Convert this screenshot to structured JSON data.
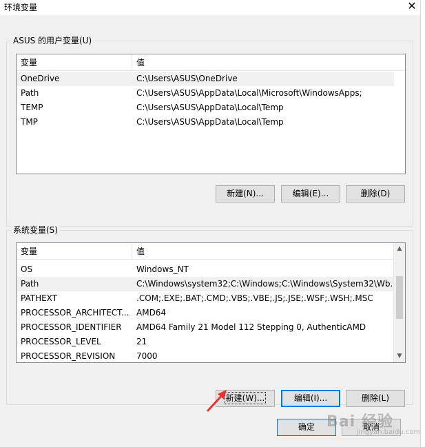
{
  "window": {
    "title": "环境变量",
    "close_glyph": "✕"
  },
  "user_vars": {
    "group_label": "ASUS 的用户变量(U)",
    "columns": [
      "变量",
      "值"
    ],
    "rows": [
      {
        "name": "OneDrive",
        "value": "C:\\Users\\ASUS\\OneDrive",
        "selected": true
      },
      {
        "name": "Path",
        "value": "C:\\Users\\ASUS\\AppData\\Local\\Microsoft\\WindowsApps;",
        "selected": false
      },
      {
        "name": "TEMP",
        "value": "C:\\Users\\ASUS\\AppData\\Local\\Temp",
        "selected": false
      },
      {
        "name": "TMP",
        "value": "C:\\Users\\ASUS\\AppData\\Local\\Temp",
        "selected": false
      }
    ],
    "buttons": {
      "new": "新建(N)...",
      "edit": "编辑(E)...",
      "delete": "删除(D)"
    }
  },
  "system_vars": {
    "group_label": "系统变量(S)",
    "columns": [
      "变量",
      "值"
    ],
    "rows": [
      {
        "name": "OS",
        "value": "Windows_NT",
        "selected": false
      },
      {
        "name": "Path",
        "value": "C:\\Windows\\system32;C:\\Windows;C:\\Windows\\System32\\Wb...",
        "selected": true
      },
      {
        "name": "PATHEXT",
        "value": ".COM;.EXE;.BAT;.CMD;.VBS;.VBE;.JS;.JSE;.WSF;.WSH;.MSC",
        "selected": false
      },
      {
        "name": "PROCESSOR_ARCHITECT...",
        "value": "AMD64",
        "selected": false
      },
      {
        "name": "PROCESSOR_IDENTIFIER",
        "value": "AMD64 Family 21 Model 112 Stepping 0, AuthenticAMD",
        "selected": false
      },
      {
        "name": "PROCESSOR_LEVEL",
        "value": "21",
        "selected": false
      },
      {
        "name": "PROCESSOR_REVISION",
        "value": "7000",
        "selected": false
      }
    ],
    "buttons": {
      "new": "新建(W)...",
      "edit": "编辑(I)...",
      "delete": "删除(L)"
    }
  },
  "footer": {
    "ok": "确定",
    "cancel": "取消"
  },
  "watermark": {
    "main": "Bai 经验",
    "sub": "jingyan.baidu.com"
  },
  "colors": {
    "annotation_arrow": "#e8332a",
    "focus_border": "#0078d7",
    "selected_row": "#f0f0f0"
  },
  "icons": {
    "scroll_up": "chevron-up-icon",
    "scroll_down": "chevron-down-icon",
    "annotation": "red-arrow-icon"
  }
}
